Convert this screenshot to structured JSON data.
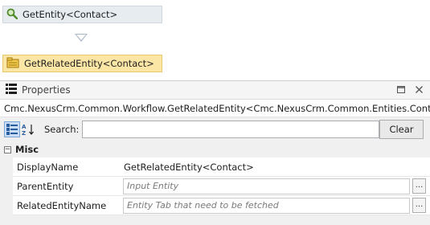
{
  "designer": {
    "activities": [
      {
        "label": "GetEntity<Contact>",
        "icon": "magnifier-icon"
      },
      {
        "label": "GetRelatedEntity<Contact>",
        "icon": "folder-activity-icon"
      }
    ]
  },
  "properties": {
    "title": "Properties",
    "type_name": "Cmc.NexusCrm.Common.Workflow.GetRelatedEntity<Cmc.NexusCrm.Common.Entities.Contact>",
    "search_label": "Search:",
    "search_value": "",
    "clear_label": "Clear",
    "category": "Misc",
    "rows": [
      {
        "name": "DisplayName",
        "value": "GetRelatedEntity<Contact>"
      },
      {
        "name": "ParentEntity",
        "placeholder": "Input Entity"
      },
      {
        "name": "RelatedEntityName",
        "placeholder": "Entity Tab that need to be fetched"
      }
    ]
  },
  "colors": {
    "activity_default": "#e7ecf1",
    "activity_selected": "#fbe6a6",
    "connector": "#a9b6c6"
  }
}
